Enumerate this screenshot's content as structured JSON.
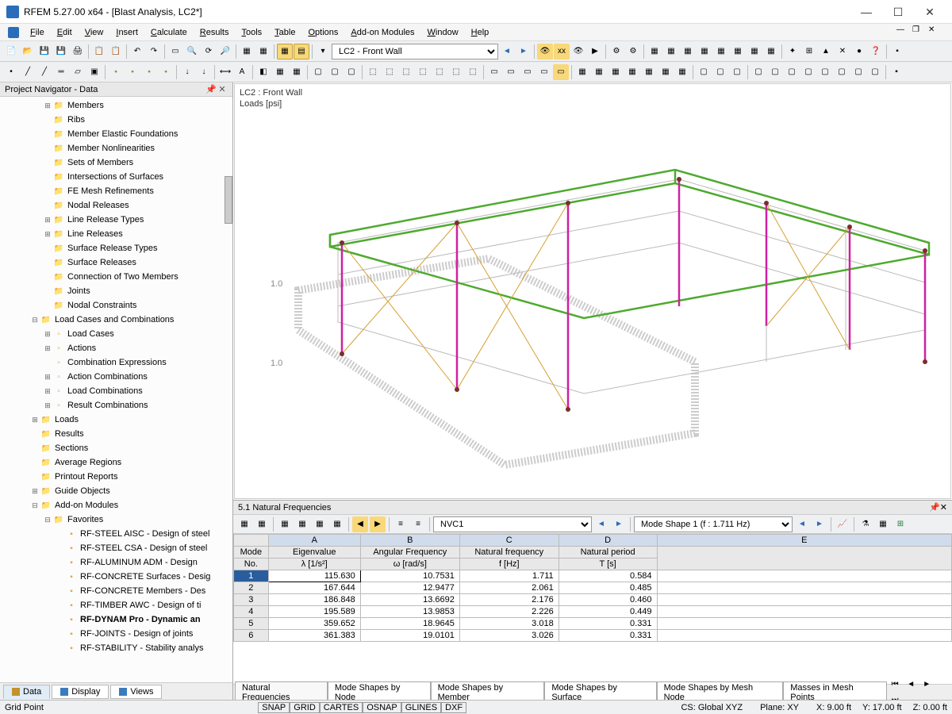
{
  "title": "RFEM 5.27.00 x64 - [Blast Analysis, LC2*]",
  "menus": [
    "File",
    "Edit",
    "View",
    "Insert",
    "Calculate",
    "Results",
    "Tools",
    "Table",
    "Options",
    "Add-on Modules",
    "Window",
    "Help"
  ],
  "load_case_combo": "LC2 - Front Wall",
  "navigator": {
    "title": "Project Navigator - Data",
    "items": [
      {
        "lvl": 3,
        "exp": "+",
        "ico": "📁",
        "label": "Members"
      },
      {
        "lvl": 3,
        "exp": "",
        "ico": "📁",
        "label": "Ribs"
      },
      {
        "lvl": 3,
        "exp": "",
        "ico": "📁",
        "label": "Member Elastic Foundations"
      },
      {
        "lvl": 3,
        "exp": "",
        "ico": "📁",
        "label": "Member Nonlinearities"
      },
      {
        "lvl": 3,
        "exp": "",
        "ico": "📁",
        "label": "Sets of Members"
      },
      {
        "lvl": 3,
        "exp": "",
        "ico": "📁",
        "label": "Intersections of Surfaces"
      },
      {
        "lvl": 3,
        "exp": "",
        "ico": "📁",
        "label": "FE Mesh Refinements"
      },
      {
        "lvl": 3,
        "exp": "",
        "ico": "📁",
        "label": "Nodal Releases"
      },
      {
        "lvl": 3,
        "exp": "+",
        "ico": "📁",
        "label": "Line Release Types"
      },
      {
        "lvl": 3,
        "exp": "+",
        "ico": "📁",
        "label": "Line Releases"
      },
      {
        "lvl": 3,
        "exp": "",
        "ico": "📁",
        "label": "Surface Release Types"
      },
      {
        "lvl": 3,
        "exp": "",
        "ico": "📁",
        "label": "Surface Releases"
      },
      {
        "lvl": 3,
        "exp": "",
        "ico": "📁",
        "label": "Connection of Two Members"
      },
      {
        "lvl": 3,
        "exp": "",
        "ico": "📁",
        "label": "Joints"
      },
      {
        "lvl": 3,
        "exp": "",
        "ico": "📁",
        "label": "Nodal Constraints"
      },
      {
        "lvl": 2,
        "exp": "-",
        "ico": "📁",
        "label": "Load Cases and Combinations"
      },
      {
        "lvl": 3,
        "exp": "+",
        "ico": "▫",
        "label": "Load Cases"
      },
      {
        "lvl": 3,
        "exp": "+",
        "ico": "▫",
        "label": "Actions"
      },
      {
        "lvl": 3,
        "exp": "",
        "ico": "▫",
        "label": "Combination Expressions"
      },
      {
        "lvl": 3,
        "exp": "+",
        "ico": "▫",
        "label": "Action Combinations"
      },
      {
        "lvl": 3,
        "exp": "+",
        "ico": "▫",
        "label": "Load Combinations"
      },
      {
        "lvl": 3,
        "exp": "+",
        "ico": "▫",
        "label": "Result Combinations"
      },
      {
        "lvl": 2,
        "exp": "+",
        "ico": "📁",
        "label": "Loads"
      },
      {
        "lvl": 2,
        "exp": "",
        "ico": "📁",
        "label": "Results"
      },
      {
        "lvl": 2,
        "exp": "",
        "ico": "📁",
        "label": "Sections"
      },
      {
        "lvl": 2,
        "exp": "",
        "ico": "📁",
        "label": "Average Regions"
      },
      {
        "lvl": 2,
        "exp": "",
        "ico": "📁",
        "label": "Printout Reports"
      },
      {
        "lvl": 2,
        "exp": "+",
        "ico": "📁",
        "label": "Guide Objects"
      },
      {
        "lvl": 2,
        "exp": "-",
        "ico": "📁",
        "label": "Add-on Modules"
      },
      {
        "lvl": 3,
        "exp": "-",
        "ico": "📁",
        "label": "Favorites"
      },
      {
        "lvl": 4,
        "exp": "",
        "ico": "▪",
        "label": "RF-STEEL AISC - Design of steel"
      },
      {
        "lvl": 4,
        "exp": "",
        "ico": "▪",
        "label": "RF-STEEL CSA - Design of steel"
      },
      {
        "lvl": 4,
        "exp": "",
        "ico": "▪",
        "label": "RF-ALUMINUM ADM - Design"
      },
      {
        "lvl": 4,
        "exp": "",
        "ico": "▪",
        "label": "RF-CONCRETE Surfaces - Desig"
      },
      {
        "lvl": 4,
        "exp": "",
        "ico": "▪",
        "label": "RF-CONCRETE Members - Des"
      },
      {
        "lvl": 4,
        "exp": "",
        "ico": "▪",
        "label": "RF-TIMBER AWC - Design of ti"
      },
      {
        "lvl": 4,
        "exp": "",
        "ico": "▪",
        "label": "RF-DYNAM Pro - Dynamic an",
        "bold": true
      },
      {
        "lvl": 4,
        "exp": "",
        "ico": "▪",
        "label": "RF-JOINTS - Design of joints"
      },
      {
        "lvl": 4,
        "exp": "",
        "ico": "▪",
        "label": "RF-STABILITY - Stability analys"
      }
    ],
    "tabs": [
      "Data",
      "Display",
      "Views"
    ]
  },
  "viewport": {
    "line1": "LC2 : Front Wall",
    "line2": "Loads [psi]",
    "axis_label": "1.0"
  },
  "panel": {
    "title": "5.1 Natural Frequencies",
    "combo1": "NVC1",
    "combo2": "Mode Shape 1 (f : 1.711 Hz)",
    "col_letters": [
      "A",
      "B",
      "C",
      "D",
      "E"
    ],
    "headers_row1": [
      "Mode",
      "Eigenvalue",
      "Angular Frequency",
      "Natural frequency",
      "Natural period"
    ],
    "headers_row2": [
      "No.",
      "λ [1/s²]",
      "ω [rad/s]",
      "f [Hz]",
      "T [s]"
    ],
    "rows": [
      {
        "no": "1",
        "a": "115.630",
        "b": "10.7531",
        "c": "1.711",
        "d": "0.584",
        "sel": true
      },
      {
        "no": "2",
        "a": "167.644",
        "b": "12.9477",
        "c": "2.061",
        "d": "0.485"
      },
      {
        "no": "3",
        "a": "186.848",
        "b": "13.6692",
        "c": "2.176",
        "d": "0.460"
      },
      {
        "no": "4",
        "a": "195.589",
        "b": "13.9853",
        "c": "2.226",
        "d": "0.449"
      },
      {
        "no": "5",
        "a": "359.652",
        "b": "18.9645",
        "c": "3.018",
        "d": "0.331"
      },
      {
        "no": "6",
        "a": "361.383",
        "b": "19.0101",
        "c": "3.026",
        "d": "0.331"
      }
    ],
    "tabs": [
      "Natural Frequencies",
      "Mode Shapes by Node",
      "Mode Shapes by Member",
      "Mode Shapes by Surface",
      "Mode Shapes by Mesh Node",
      "Masses in Mesh Points"
    ]
  },
  "status": {
    "left": "Grid Point",
    "toggles": [
      "SNAP",
      "GRID",
      "CARTES",
      "OSNAP",
      "GLINES",
      "DXF"
    ],
    "cs": "CS: Global XYZ",
    "plane": "Plane: XY",
    "x": "X:   9.00 ft",
    "y": "Y:   17.00 ft",
    "z": "Z:   0.00 ft"
  },
  "chart_data": {
    "type": "table",
    "title": "5.1 Natural Frequencies",
    "columns": [
      "Mode No.",
      "Eigenvalue λ [1/s²]",
      "Angular Frequency ω [rad/s]",
      "Natural frequency f [Hz]",
      "Natural period T [s]"
    ],
    "rows": [
      [
        1,
        115.63,
        10.7531,
        1.711,
        0.584
      ],
      [
        2,
        167.644,
        12.9477,
        2.061,
        0.485
      ],
      [
        3,
        186.848,
        13.6692,
        2.176,
        0.46
      ],
      [
        4,
        195.589,
        13.9853,
        2.226,
        0.449
      ],
      [
        5,
        359.652,
        18.9645,
        3.018,
        0.331
      ],
      [
        6,
        361.383,
        19.0101,
        3.026,
        0.331
      ]
    ]
  }
}
